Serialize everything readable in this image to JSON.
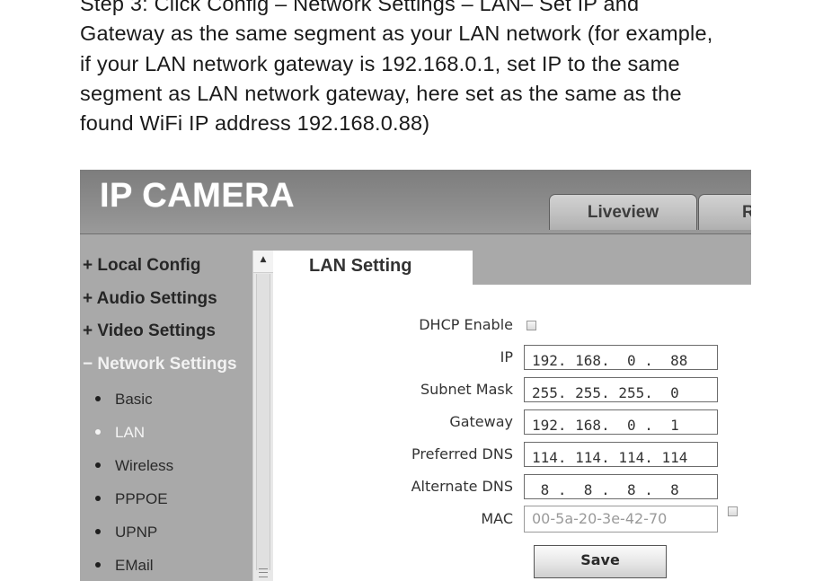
{
  "instructions": {
    "lines": [
      "Step 3: Click Config – Network Settings – LAN– Set IP and",
      "Gateway as the same segment as your LAN network (for example,",
      "if your LAN network gateway is 192.168.0.1, set IP to the same",
      "segment as LAN network gateway, here set as the same as the",
      "found WiFi IP address 192.168.0.88)"
    ]
  },
  "camera_ui": {
    "logo": "IP CAMERA",
    "nav_tabs": [
      {
        "label": "Liveview"
      },
      {
        "label": "R"
      }
    ],
    "sidebar": {
      "menu": [
        {
          "label": "+ Local Config",
          "expanded": false
        },
        {
          "label": "+ Audio Settings",
          "expanded": false
        },
        {
          "label": "+ Video Settings",
          "expanded": false
        },
        {
          "label": "− Network Settings",
          "expanded": true,
          "active": true
        }
      ],
      "submenu": [
        {
          "label": "Basic"
        },
        {
          "label": "LAN",
          "active": true
        },
        {
          "label": "Wireless"
        },
        {
          "label": "PPPOE"
        },
        {
          "label": "UPNP"
        },
        {
          "label": "EMail"
        }
      ],
      "scroll_up_icon": "▲"
    },
    "content": {
      "tab_title": "LAN Setting",
      "dhcp": {
        "label": "DHCP Enable",
        "checked": false
      },
      "fields": [
        {
          "label": "IP",
          "value": "192. 168.  0 .  88"
        },
        {
          "label": "Subnet Mask",
          "value": "255. 255. 255.  0"
        },
        {
          "label": "Gateway",
          "value": "192. 168.  0 .  1"
        },
        {
          "label": "Preferred DNS",
          "value": "114. 114. 114. 114"
        },
        {
          "label": "Alternate DNS",
          "value": " 8 .  8 .  8 .  8"
        }
      ],
      "mac": {
        "label": "MAC",
        "value": "00-5a-20-3e-42-70",
        "checked": false
      },
      "save_label": "Save"
    }
  }
}
